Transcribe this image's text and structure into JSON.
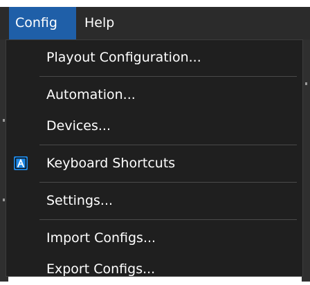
{
  "menubar": {
    "items": [
      {
        "label": "Config"
      },
      {
        "label": "Help"
      }
    ]
  },
  "dropdown": {
    "items": [
      {
        "label": "Playout Configuration..."
      },
      {
        "label": "Automation..."
      },
      {
        "label": "Devices..."
      },
      {
        "label": "Keyboard Shortcuts",
        "icon": "keyboard-shortcuts-icon"
      },
      {
        "label": "Settings..."
      },
      {
        "label": "Import Configs..."
      },
      {
        "label": "Export Configs..."
      }
    ]
  },
  "colors": {
    "menubar_bg": "#2b2b2b",
    "active_menu_bg": "#1f5fa8",
    "dropdown_bg": "#1f1f1f",
    "separator": "#4a4a4a",
    "icon_blue": "#1e88e5"
  }
}
